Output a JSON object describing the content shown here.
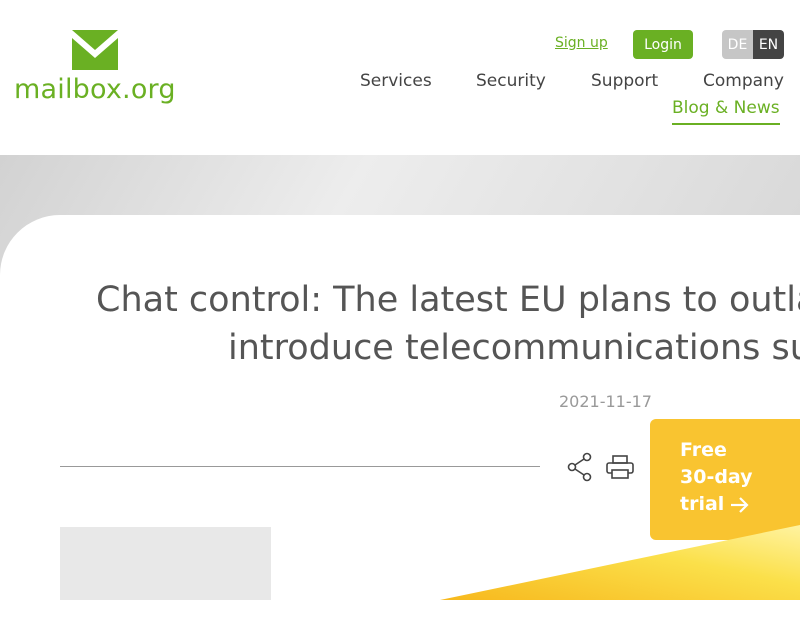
{
  "header": {
    "logo_text": "mailbox.org",
    "signup_label": "Sign up",
    "login_label": "Login",
    "lang_de": "DE",
    "lang_en": "EN"
  },
  "nav": {
    "items": [
      "Services",
      "Security",
      "Support",
      "Company"
    ],
    "active": "Blog & News"
  },
  "article": {
    "title_line1": "Chat control: The latest EU plans to outla",
    "title_line2": "introduce telecommunications su",
    "date": "2021-11-17"
  },
  "cta": {
    "line1": "Free",
    "line2": "30-day",
    "line3": "trial"
  },
  "icons": [
    "envelope-logo-icon",
    "share-icon",
    "print-icon",
    "arrow-right-icon"
  ],
  "colors": {
    "brand_green": "#6ab023",
    "cta_yellow": "#f9c430",
    "lang_active": "#444444"
  }
}
